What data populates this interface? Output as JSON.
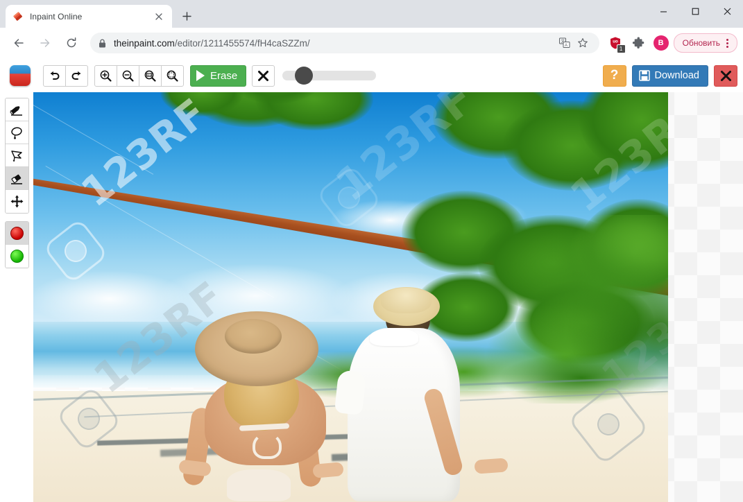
{
  "browser": {
    "tab": {
      "title": "Inpaint Online",
      "favicon_icon": "eraser-favicon",
      "close_icon": "close-icon"
    },
    "newtab_icon": "plus-icon",
    "window_controls": {
      "minimize_icon": "minimize-icon",
      "maximize_icon": "maximize-icon",
      "close_icon": "close-icon"
    },
    "nav": {
      "back_icon": "back-arrow-icon",
      "forward_icon": "forward-arrow-icon",
      "reload_icon": "reload-icon"
    },
    "omnibox": {
      "lock_icon": "lock-icon",
      "url_host": "theinpaint.com",
      "url_path": "/editor/1211455574/fH4caSZZm/",
      "translate_icon": "translate-icon",
      "bookmark_icon": "star-icon"
    },
    "extensions": {
      "ublock_icon": "ublock-origin-icon",
      "ublock_badge": "1",
      "puzzle_icon": "extensions-puzzle-icon"
    },
    "profile": {
      "avatar_initial": "B",
      "avatar_color": "#e5246f"
    },
    "update_button": {
      "label": "Обновить",
      "color": "#b3254f"
    },
    "menu_icon": "three-dot-menu-icon"
  },
  "app": {
    "logo_icon": "inpaint-logo-icon",
    "toolbar": {
      "undo": {
        "label": "",
        "icon": "undo-arrow-icon"
      },
      "redo": {
        "label": "",
        "icon": "redo-arrow-icon"
      },
      "zoom_in": {
        "icon": "zoom-in-icon"
      },
      "zoom_out": {
        "icon": "zoom-out-icon"
      },
      "zoom_actual": {
        "icon": "zoom-one-to-one-icon"
      },
      "zoom_fit": {
        "icon": "zoom-fit-icon"
      },
      "erase_label": "Erase",
      "erase_icon": "play-triangle-icon",
      "erase_color": "#4caf50",
      "cancel_icon": "x-icon",
      "brush_slider": {
        "value_percent": 18
      },
      "help_label": "?",
      "help_color": "#f0ad4e",
      "download_label": "Download",
      "download_icon": "floppy-disk-icon",
      "download_color": "#337ab7",
      "close_icon": "x-icon",
      "close_color": "#e05b5b"
    },
    "sidebar": {
      "tools": [
        {
          "name": "marker-tool",
          "icon": "marker-pen-icon",
          "active": false
        },
        {
          "name": "lasso-tool",
          "icon": "lasso-ellipse-icon",
          "active": false
        },
        {
          "name": "polygon-lasso-tool",
          "icon": "polygon-lasso-icon",
          "active": false
        },
        {
          "name": "eraser-tool",
          "icon": "eraser-icon",
          "active": true
        },
        {
          "name": "move-tool",
          "icon": "move-arrows-icon",
          "active": false
        }
      ],
      "colors": [
        {
          "name": "red-marker-color",
          "color": "#c80000",
          "active": true
        },
        {
          "name": "green-marker-color",
          "color": "#13b300",
          "active": false
        }
      ]
    },
    "canvas": {
      "image_description": "Couple sitting on tropical beach under palm trees",
      "watermark_text": "123RF",
      "watermark_badge_icon": "123rf-badge-icon",
      "background": "transparency-checkerboard"
    }
  }
}
